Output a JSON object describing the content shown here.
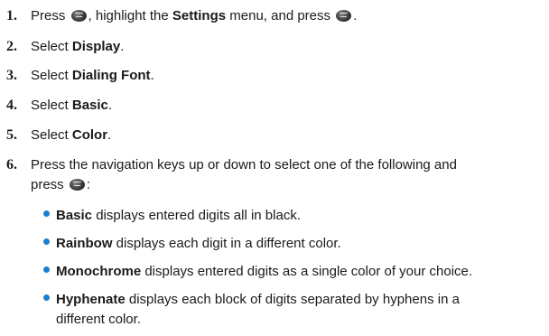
{
  "steps": [
    {
      "num": "1.",
      "p1": "Press",
      "p2": ", highlight the",
      "b1": "Settings",
      "p3": "menu, and press",
      "p4": "."
    },
    {
      "num": "2.",
      "p1": "Select",
      "b1": "Display",
      "p2": "."
    },
    {
      "num": "3.",
      "p1": "Select",
      "b1": "Dialing Font",
      "p2": "."
    },
    {
      "num": "4.",
      "p1": "Select",
      "b1": "Basic",
      "p2": "."
    },
    {
      "num": "5.",
      "p1": "Select",
      "b1": "Color",
      "p2": "."
    },
    {
      "num": "6.",
      "line1": "Press the navigation keys up or down to select one of the following and",
      "line2": "press",
      "line2_end": ":"
    }
  ],
  "bullets": [
    {
      "bold": "Basic",
      "text": "displays entered digits all in black."
    },
    {
      "bold": "Rainbow",
      "text": "displays each digit in a different color."
    },
    {
      "bold": "Monochrome",
      "text": "displays entered digits as a single color of your choice."
    },
    {
      "bold": "Hyphenate",
      "text": "displays each block of digits separated by hyphens in a",
      "text2": "different color."
    }
  ],
  "icons": {
    "key": "menu-ok-key-icon"
  },
  "colors": {
    "bullet": "#1a7fd0",
    "text": "#1a1a1a"
  }
}
